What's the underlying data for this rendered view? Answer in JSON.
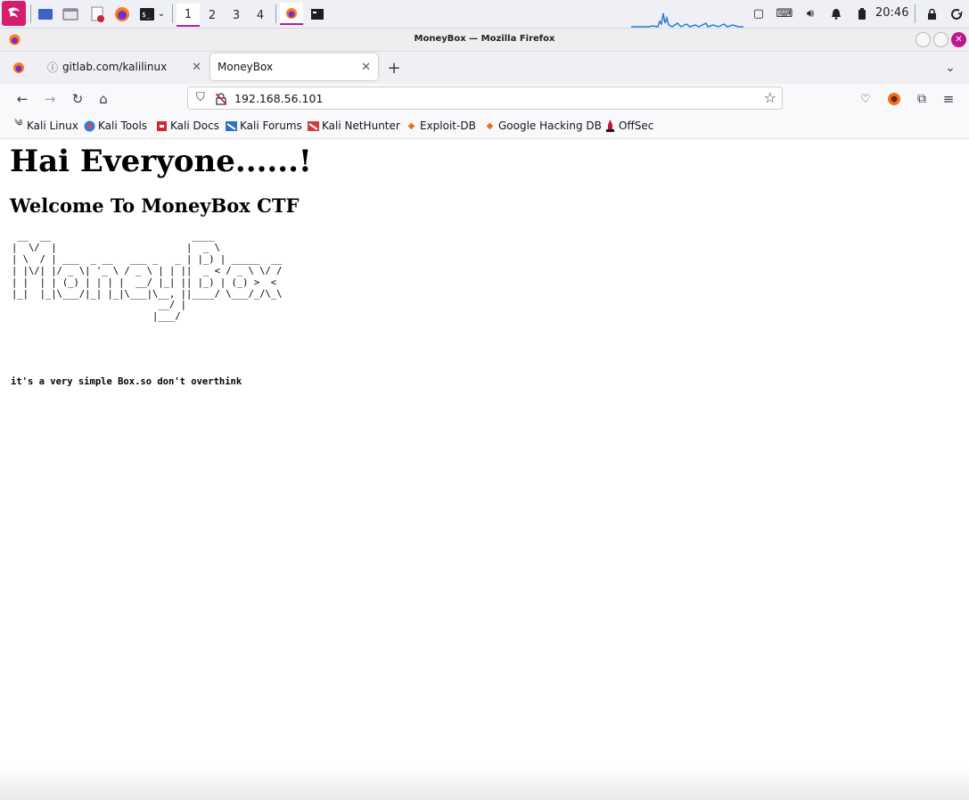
{
  "panel": {
    "workspaces": [
      "1",
      "2",
      "3",
      "4"
    ],
    "clock": "20:46",
    "accent": "#b61fa0"
  },
  "window": {
    "title": "MoneyBox — Mozilla Firefox"
  },
  "tabs": [
    {
      "label": "gitlab.com/kalilinux"
    },
    {
      "label": "MoneyBox"
    }
  ],
  "urlbar": {
    "url": "192.168.56.101"
  },
  "bookmarks": [
    {
      "label": "Kali Linux",
      "icon": "kali-dragon-icon"
    },
    {
      "label": "Kali Tools",
      "icon": "kali-tools-icon"
    },
    {
      "label": "Kali Docs",
      "icon": "kali-docs-icon"
    },
    {
      "label": "Kali Forums",
      "icon": "kali-forums-icon"
    },
    {
      "label": "Kali NetHunter",
      "icon": "nethunter-icon"
    },
    {
      "label": "Exploit-DB",
      "icon": "exploit-db-icon"
    },
    {
      "label": "Google Hacking DB",
      "icon": "ghdb-icon"
    },
    {
      "label": "OffSec",
      "icon": "offsec-icon"
    }
  ],
  "page": {
    "heading": "Hai Everyone......!",
    "subheading": "Welcome To MoneyBox CTF",
    "ascii_art": " __  __                         ____\n|  \\/  |                       |  _ \\\n| \\  / | ___  _ __   ___ _   _ | |_) | _____  __\n| |\\/| |/ _ \\| '_ \\ / _ \\ | | ||  _ < / _ \\ \\/ /\n| |  | | (_) | | | |  __/ |_| || |_) | (_) >  <\n|_|  |_|\\___/|_| |_|\\___|\\__, ||____/ \\___/_/\\_\\\n                          __/ |\n                         |___/",
    "note": "it's a very simple Box.so don't overthink"
  }
}
